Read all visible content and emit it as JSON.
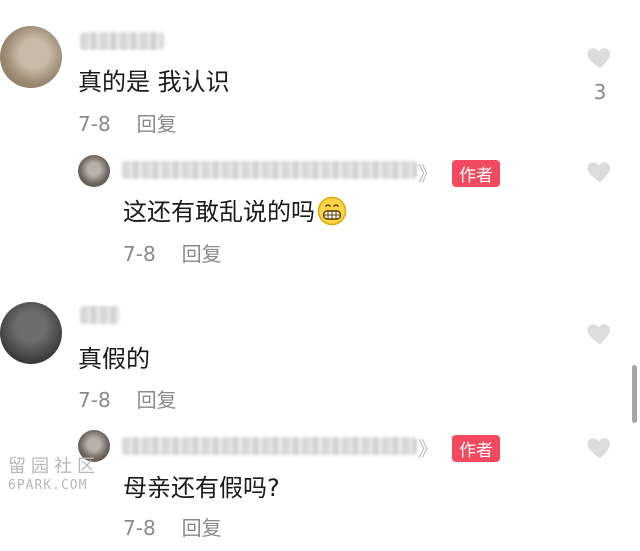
{
  "comments": [
    {
      "text": "真的是 我认识",
      "date": "7-8",
      "reply_label": "回复",
      "like_count": "3",
      "reply": {
        "chevron": "》",
        "author_badge": "作者",
        "text": "这还有敢乱说的吗",
        "emoji": "grinning-face-icon",
        "date": "7-8",
        "reply_label": "回复"
      }
    },
    {
      "text": "真假的",
      "date": "7-8",
      "reply_label": "回复",
      "reply": {
        "chevron": "》",
        "author_badge": "作者",
        "text": "母亲还有假吗?",
        "date": "7-8",
        "reply_label": "回复"
      }
    }
  ],
  "watermark": {
    "top": "留园社区",
    "bottom": "6PARK.COM"
  },
  "colors": {
    "badge": "#f34a5f",
    "meta": "#8a8a8a",
    "heart": "#dcdcdc"
  }
}
